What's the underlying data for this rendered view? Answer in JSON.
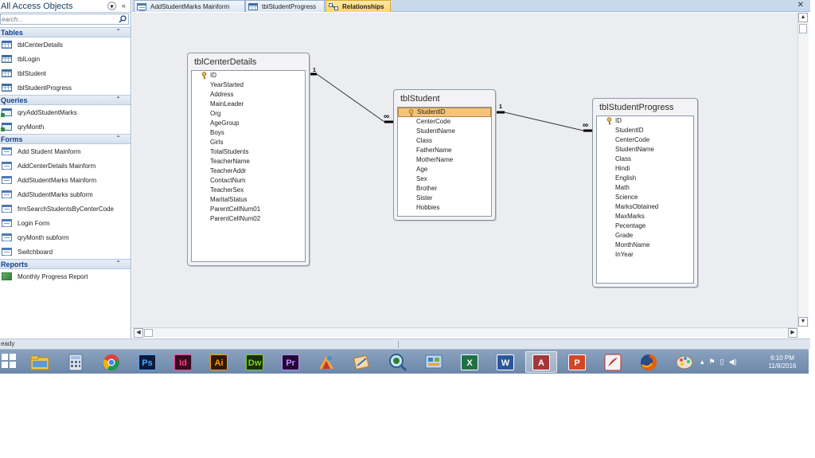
{
  "nav": {
    "title": "All Access Objects",
    "search_placeholder": "earch...",
    "groups": [
      {
        "label": "Tables",
        "items": [
          "tblCenterDetails",
          "tblLogin",
          "tblStudent",
          "tblStudentProgress"
        ]
      },
      {
        "label": "Queries",
        "items": [
          "qryAddStudentMarks",
          "qryMonth"
        ]
      },
      {
        "label": "Forms",
        "items": [
          "Add Student Mainform",
          "AddCenterDetails Mainform",
          "AddStudentMarks Mainform",
          "AddStudentMarks subform",
          "frmSearchStudentsByCenterCode",
          "Login Form",
          "qryMonth subform",
          "Switchboard"
        ]
      },
      {
        "label": "Reports",
        "items": [
          "Monthly Progress Report"
        ]
      }
    ]
  },
  "tabs": [
    {
      "label": "AddStudentMarks Mainform",
      "icon": "form-icon"
    },
    {
      "label": "tblStudentProgress",
      "icon": "table-icon"
    },
    {
      "label": "Relationships",
      "icon": "relationships-icon",
      "active": true
    }
  ],
  "tables": [
    {
      "name": "tblCenterDetails",
      "key": "ID",
      "fields": [
        "YearStarted",
        "Address",
        "MainLeader",
        "Org",
        "AgeGroup",
        "Boys",
        "Girls",
        "TotalStudents",
        "TeacherName",
        "TeacherAddr",
        "ContactNum",
        "TeacherSex",
        "MaritalStatus",
        "ParentCellNum01",
        "ParentCellNum02"
      ]
    },
    {
      "name": "tblStudent",
      "key": "StudentID",
      "fields": [
        "CenterCode",
        "StudentName",
        "Class",
        "FatherName",
        "MotherName",
        "Age",
        "Sex",
        "Brother",
        "Sister",
        "Hobbies"
      ]
    },
    {
      "name": "tblStudentProgress",
      "key": "ID",
      "fields": [
        "StudentID",
        "CenterCode",
        "StudentName",
        "Class",
        "Hindi",
        "English",
        "Math",
        "Science",
        "MarksObtained",
        "MaxMarks",
        "Pecentage",
        "Grade",
        "MonthName",
        "InYear"
      ]
    }
  ],
  "relationships": [
    {
      "one": "1",
      "many": "∞"
    },
    {
      "one": "1",
      "many": "∞"
    }
  ],
  "status": "eady",
  "taskbar": {
    "apps": [
      {
        "name": "explorer-icon",
        "label": ""
      },
      {
        "name": "calculator-icon",
        "label": ""
      },
      {
        "name": "chrome-icon",
        "label": ""
      },
      {
        "name": "photoshop-icon",
        "label": "Ps",
        "bg": "#0c1a3a",
        "fg": "#4aa8ff"
      },
      {
        "name": "indesign-icon",
        "label": "Id",
        "bg": "#3a0a1e",
        "fg": "#ff3d8b"
      },
      {
        "name": "illustrator-icon",
        "label": "Ai",
        "bg": "#2e1a03",
        "fg": "#ff9a00"
      },
      {
        "name": "dreamweaver-icon",
        "label": "Dw",
        "bg": "#1b2e0a",
        "fg": "#7ad321"
      },
      {
        "name": "premiere-icon",
        "label": "Pr",
        "bg": "#1f0a33",
        "fg": "#c88aff"
      },
      {
        "name": "paint-icon",
        "label": ""
      },
      {
        "name": "app-icon",
        "label": ""
      },
      {
        "name": "magnifier-icon",
        "label": ""
      },
      {
        "name": "control-panel-icon",
        "label": ""
      },
      {
        "name": "excel-icon",
        "label": "X",
        "bg": "#1e7145",
        "fg": "#ffffff"
      },
      {
        "name": "word-icon",
        "label": "W",
        "bg": "#2b579a",
        "fg": "#ffffff"
      },
      {
        "name": "access-icon",
        "label": "A",
        "bg": "#a4373a",
        "fg": "#ffffff",
        "active": true
      },
      {
        "name": "powerpoint-icon",
        "label": "P",
        "bg": "#d24726",
        "fg": "#ffffff"
      },
      {
        "name": "pdf-icon",
        "label": "",
        "bg": "#c32b2b",
        "fg": "#ffffff"
      },
      {
        "name": "firefox-icon",
        "label": ""
      },
      {
        "name": "paint-palette-icon",
        "label": ""
      }
    ],
    "time": "6:10 PM",
    "date": "11/8/2016"
  }
}
